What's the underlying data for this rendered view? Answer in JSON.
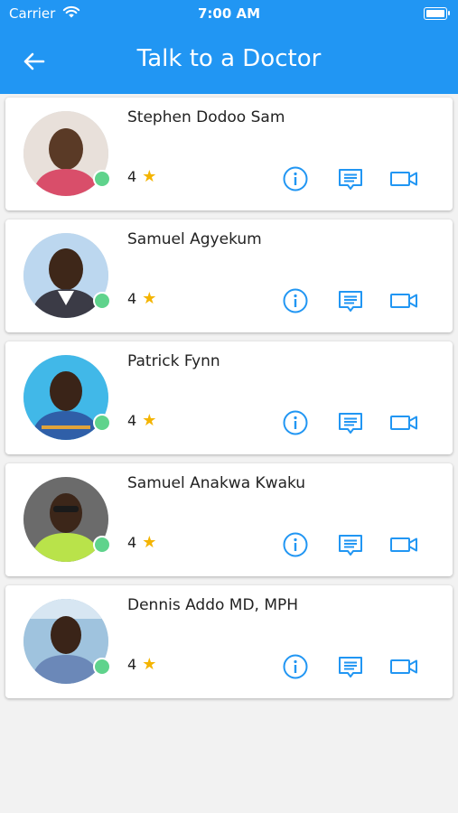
{
  "status": {
    "carrier": "Carrier",
    "time": "7:00 AM"
  },
  "header": {
    "title": "Talk to a Doctor"
  },
  "colors": {
    "primary": "#2196f3",
    "online": "#5fd38c",
    "star": "#f4b400"
  },
  "doctors": [
    {
      "name": "Stephen Dodoo Sam",
      "rating": "4",
      "bg": "#e8e0da",
      "shirt": "#d94e6a"
    },
    {
      "name": "Samuel Agyekum",
      "rating": "4",
      "bg": "#bcd7ef",
      "shirt": "#3b3b46"
    },
    {
      "name": "Patrick Fynn",
      "rating": "4",
      "bg": "#41b8e8",
      "shirt": "#2f5fa8"
    },
    {
      "name": "Samuel Anakwa Kwaku",
      "rating": "4",
      "bg": "#6b6b6b",
      "shirt": "#b9e34a"
    },
    {
      "name": "Dennis Addo MD, MPH",
      "rating": "4",
      "bg": "#9fc3de",
      "shirt": "#6b88b8"
    }
  ],
  "icons": {
    "info": "info-icon",
    "chat": "chat-icon",
    "video": "video-camera-icon",
    "back": "arrow-left-icon",
    "star": "star-icon"
  }
}
